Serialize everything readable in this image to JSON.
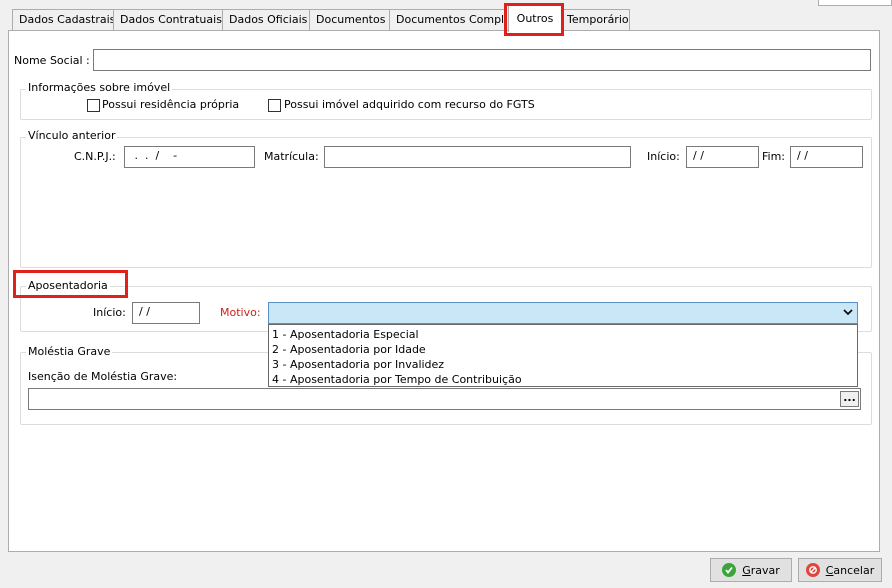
{
  "tabs": [
    "Dados Cadastrais",
    "Dados Contratuais",
    "Dados Oficiais",
    "Documentos",
    "Documentos Compl",
    "Outros",
    "Temporário"
  ],
  "nome_social": {
    "label": "Nome Social :",
    "value": ""
  },
  "imovel": {
    "legend": "Informações sobre imóvel",
    "residencia_propria": "Possui residência própria",
    "imovel_fgts": "Possui imóvel adquirido com recurso do FGTS"
  },
  "vinculo": {
    "legend": "Vínculo anterior",
    "cnpj_label": "C.N.P.J.:",
    "cnpj_value": " .  .  /    -",
    "matricula_label": "Matrícula:",
    "inicio_label": "Início:",
    "inicio_value": "/ /",
    "fim_label": "Fim:",
    "fim_value": "/ /"
  },
  "aposentadoria": {
    "legend": "Aposentadoria",
    "inicio_label": "Início:",
    "inicio_value": "/ /",
    "motivo_label": "Motivo:",
    "motivo_value": "",
    "options": [
      "1 - Aposentadoria Especial",
      "2 - Aposentadoria por Idade",
      "3 - Aposentadoria por Invalidez",
      "4 - Aposentadoria por Tempo de Contribuição"
    ]
  },
  "molestia": {
    "legend": "Moléstia Grave",
    "isencao_label": "Isenção de Moléstia Grave:",
    "ellipsis": "..."
  },
  "buttons": {
    "gravar_first": "G",
    "gravar_rest": "ravar",
    "cancelar_first": "C",
    "cancelar_rest": "ancelar"
  },
  "colors": {
    "highlight": "#e0201b",
    "motivo_label": "#d0201b",
    "select_bg": "#c9e7f7",
    "ok_icon": "#3aa53a",
    "cancel_icon": "#e0463c"
  }
}
